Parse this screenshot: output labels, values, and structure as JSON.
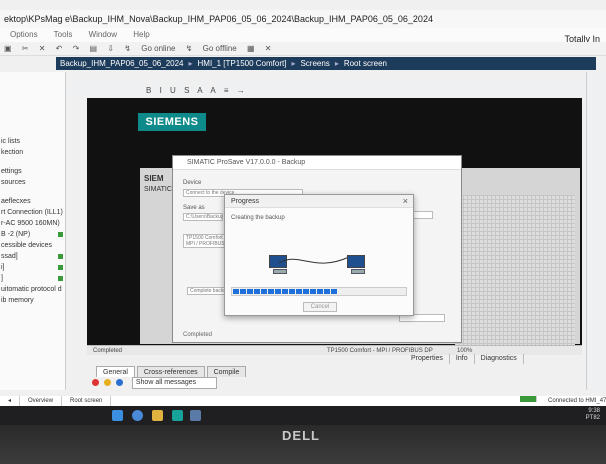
{
  "window": {
    "title": "ektop\\KPsMag e\\Backup_IHM_Nova\\Backup_IHM_PAP06_05_06_2024\\Backup_IHM_PAP06_05_06_2024",
    "brand": "Totally In"
  },
  "menu": [
    "Options",
    "Tools",
    "Window",
    "Help"
  ],
  "toolbar": {
    "go_online": "Go online",
    "go_offline": "Go offline"
  },
  "breadcrumb": [
    "Backup_IHM_PAP06_05_06_2024",
    "HMI_1 [TP1500 Comfort]",
    "Screens",
    "Root screen"
  ],
  "left_panel": {
    "items": [
      {
        "label": "ic lists",
        "status": false
      },
      {
        "label": "kection",
        "status": false
      },
      {
        "label": "ettings",
        "status": false
      },
      {
        "label": "sources",
        "status": false
      },
      {
        "label": "aeflecxes",
        "status": false
      },
      {
        "label": "rt Connection (ILL1)",
        "status": true
      },
      {
        "label": "r-AC 9500 160MN)",
        "status": true
      },
      {
        "label": "B -2 (NP)",
        "status": true
      },
      {
        "label": "cessible devices",
        "status": false
      },
      {
        "label": "ssad]",
        "status": true
      },
      {
        "label": "i]",
        "status": true
      },
      {
        "label": "]",
        "status": true
      },
      {
        "label": "uitomatic protocol d",
        "status": true
      },
      {
        "label": "ib memory",
        "status": false
      }
    ]
  },
  "edit_toolbar": [
    "B",
    "I",
    "U",
    "S",
    "A",
    "A",
    "≡",
    "→"
  ],
  "canvas": {
    "logo": "SIEMENS",
    "hmi_brand": "SIEM",
    "hmi_sub": "SIMATIC"
  },
  "backup_dialog": {
    "title": "SIMATIC ProSave V17.0.0.0 - Backup",
    "section_label": "Device",
    "field1": "Connect to the device",
    "save_label": "Save as",
    "field2": "C:\\Users\\Backup\\",
    "field3": "TP1500 Comfort\nMPI / PROFIBUS DP",
    "complete": "Complete backup",
    "bottom_status": "Completed",
    "device": "TP1500 Comfort - MPI / PROFIBUS DP"
  },
  "progress": {
    "title": "Progress",
    "status": "Creating the backup",
    "percent": 61,
    "cancel_label": "Cancel"
  },
  "status_bar": {
    "zoom": "100%"
  },
  "inspector_tabs": [
    "Properties",
    "Info",
    "Diagnostics"
  ],
  "info_tabs": [
    "General",
    "Cross-references",
    "Compile"
  ],
  "messages": {
    "filter": "Show all messages"
  },
  "portal_bar": {
    "items": [
      "Overview",
      "Root screen"
    ],
    "connection": "Connected to HMI_47_1, device"
  },
  "clock": {
    "time": "9:38",
    "date": "PT82"
  },
  "device_brand": "DELL"
}
